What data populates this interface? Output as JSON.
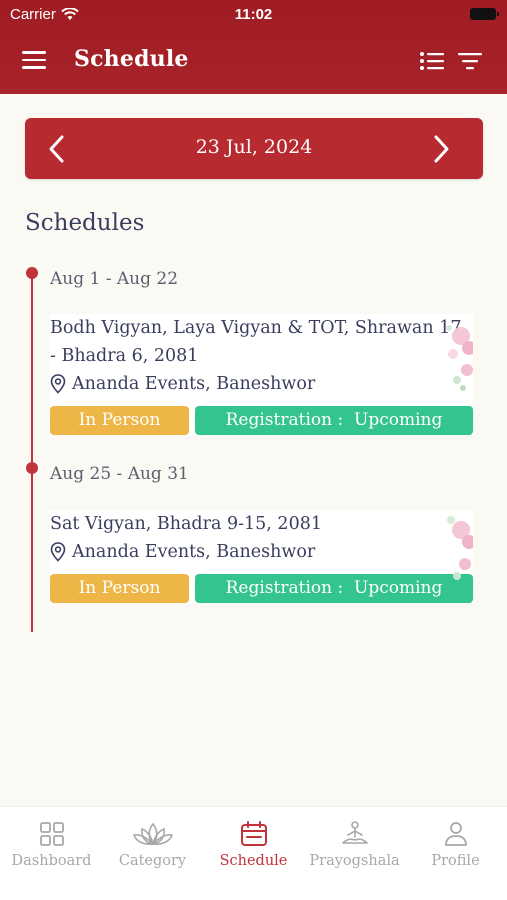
{
  "status_bar": {
    "carrier": "Carrier",
    "time": "11:02"
  },
  "header": {
    "title": "Schedule"
  },
  "date_nav": {
    "date": "23 Jul, 2024"
  },
  "section": {
    "title": "Schedules"
  },
  "schedules": [
    {
      "range": "Aug 1 - Aug 22",
      "title": "Bodh Vigyan, Laya Vigyan & TOT, Shrawan 17 - Bhadra 6, 2081",
      "location": "Ananda Events, Baneshwor",
      "mode": "In Person",
      "registration": "Registration :  Upcoming"
    },
    {
      "range": "Aug 25 - Aug 31",
      "title": "Sat Vigyan, Bhadra 9-15, 2081",
      "location": "Ananda Events, Baneshwor",
      "mode": "In Person",
      "registration": "Registration :  Upcoming"
    }
  ],
  "tabs": [
    {
      "label": "Dashboard",
      "icon": "grid-icon",
      "active": false
    },
    {
      "label": "Category",
      "icon": "lotus-icon",
      "active": false
    },
    {
      "label": "Schedule",
      "icon": "calendar-icon",
      "active": true
    },
    {
      "label": "Prayogshala",
      "icon": "meditation-icon",
      "active": false
    },
    {
      "label": "Profile",
      "icon": "person-icon",
      "active": false
    }
  ],
  "colors": {
    "header": "#a8232a",
    "date_bar": "#b72a2f",
    "in_person": "#eeb547",
    "registration": "#33c48f",
    "timeline": "#c0333a",
    "active_tab": "#c0333a"
  }
}
